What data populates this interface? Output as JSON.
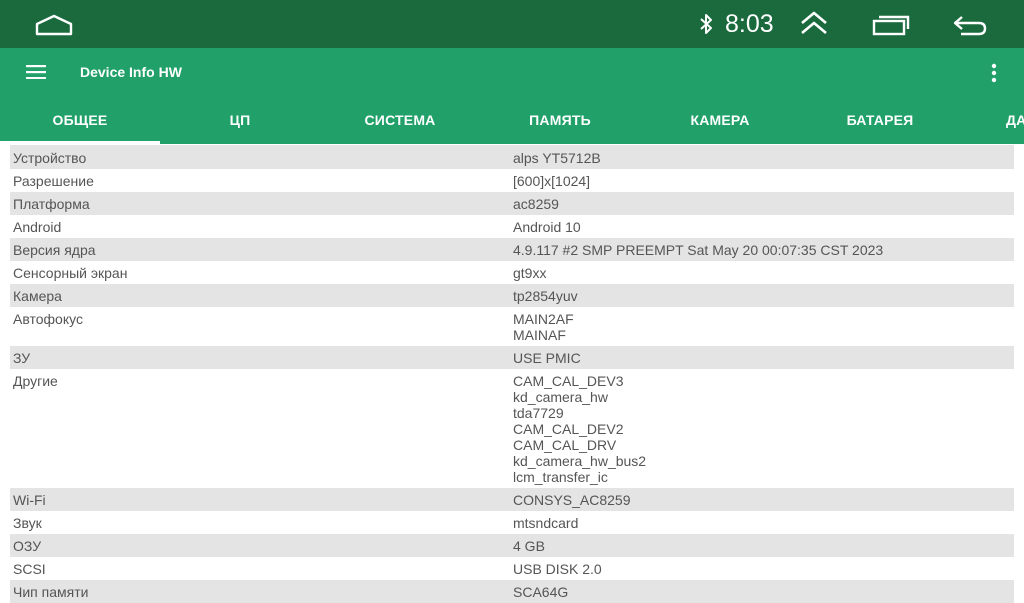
{
  "status_bar": {
    "time": "8:03",
    "icons": [
      "home-icon",
      "bluetooth-icon",
      "expand-up-icon",
      "recents-icon",
      "back-icon"
    ]
  },
  "toolbar": {
    "title": "Device Info HW",
    "icons": [
      "menu-icon",
      "more-vert-icon"
    ]
  },
  "tabs": [
    {
      "label": "ОБЩЕЕ",
      "active": true
    },
    {
      "label": "ЦП"
    },
    {
      "label": "СИСТЕМА"
    },
    {
      "label": "ПАМЯТЬ"
    },
    {
      "label": "КАМЕРА"
    },
    {
      "label": "БАТАРЕЯ"
    },
    {
      "label": "ДА"
    }
  ],
  "rows": [
    {
      "label": "Устройство",
      "value": [
        "alps YT5712B"
      ]
    },
    {
      "label": "Разрешение",
      "value": [
        "[600]x[1024]"
      ]
    },
    {
      "label": "Платформа",
      "value": [
        "ac8259"
      ]
    },
    {
      "label": "Android",
      "value": [
        "Android 10"
      ]
    },
    {
      "label": "Версия ядра",
      "value": [
        "4.9.117 #2 SMP PREEMPT Sat May 20 00:07:35 CST 2023"
      ]
    },
    {
      "label": "Сенсорный экран",
      "value": [
        "gt9xx"
      ]
    },
    {
      "label": "Камера",
      "value": [
        "tp2854yuv"
      ]
    },
    {
      "label": "Автофокус",
      "value": [
        "MAIN2AF",
        "MAINAF"
      ]
    },
    {
      "label": "ЗУ",
      "value": [
        "USE PMIC"
      ]
    },
    {
      "label": "Другие",
      "value": [
        "CAM_CAL_DEV3",
        "kd_camera_hw",
        "tda7729",
        "CAM_CAL_DEV2",
        "CAM_CAL_DRV",
        "kd_camera_hw_bus2",
        "lcm_transfer_ic"
      ]
    },
    {
      "label": "Wi-Fi",
      "value": [
        "CONSYS_AC8259"
      ]
    },
    {
      "label": "Звук",
      "value": [
        "mtsndcard"
      ]
    },
    {
      "label": "ОЗУ",
      "value": [
        "4 GB"
      ]
    },
    {
      "label": "SCSI",
      "value": [
        "USB DISK 2.0"
      ]
    },
    {
      "label": "Чип памяти",
      "value": [
        "SCA64G"
      ]
    }
  ],
  "colors": {
    "status_bar": "#1a6a3d",
    "toolbar": "#21a169",
    "row_alt": "#e4e4e4",
    "text": "#555555"
  }
}
